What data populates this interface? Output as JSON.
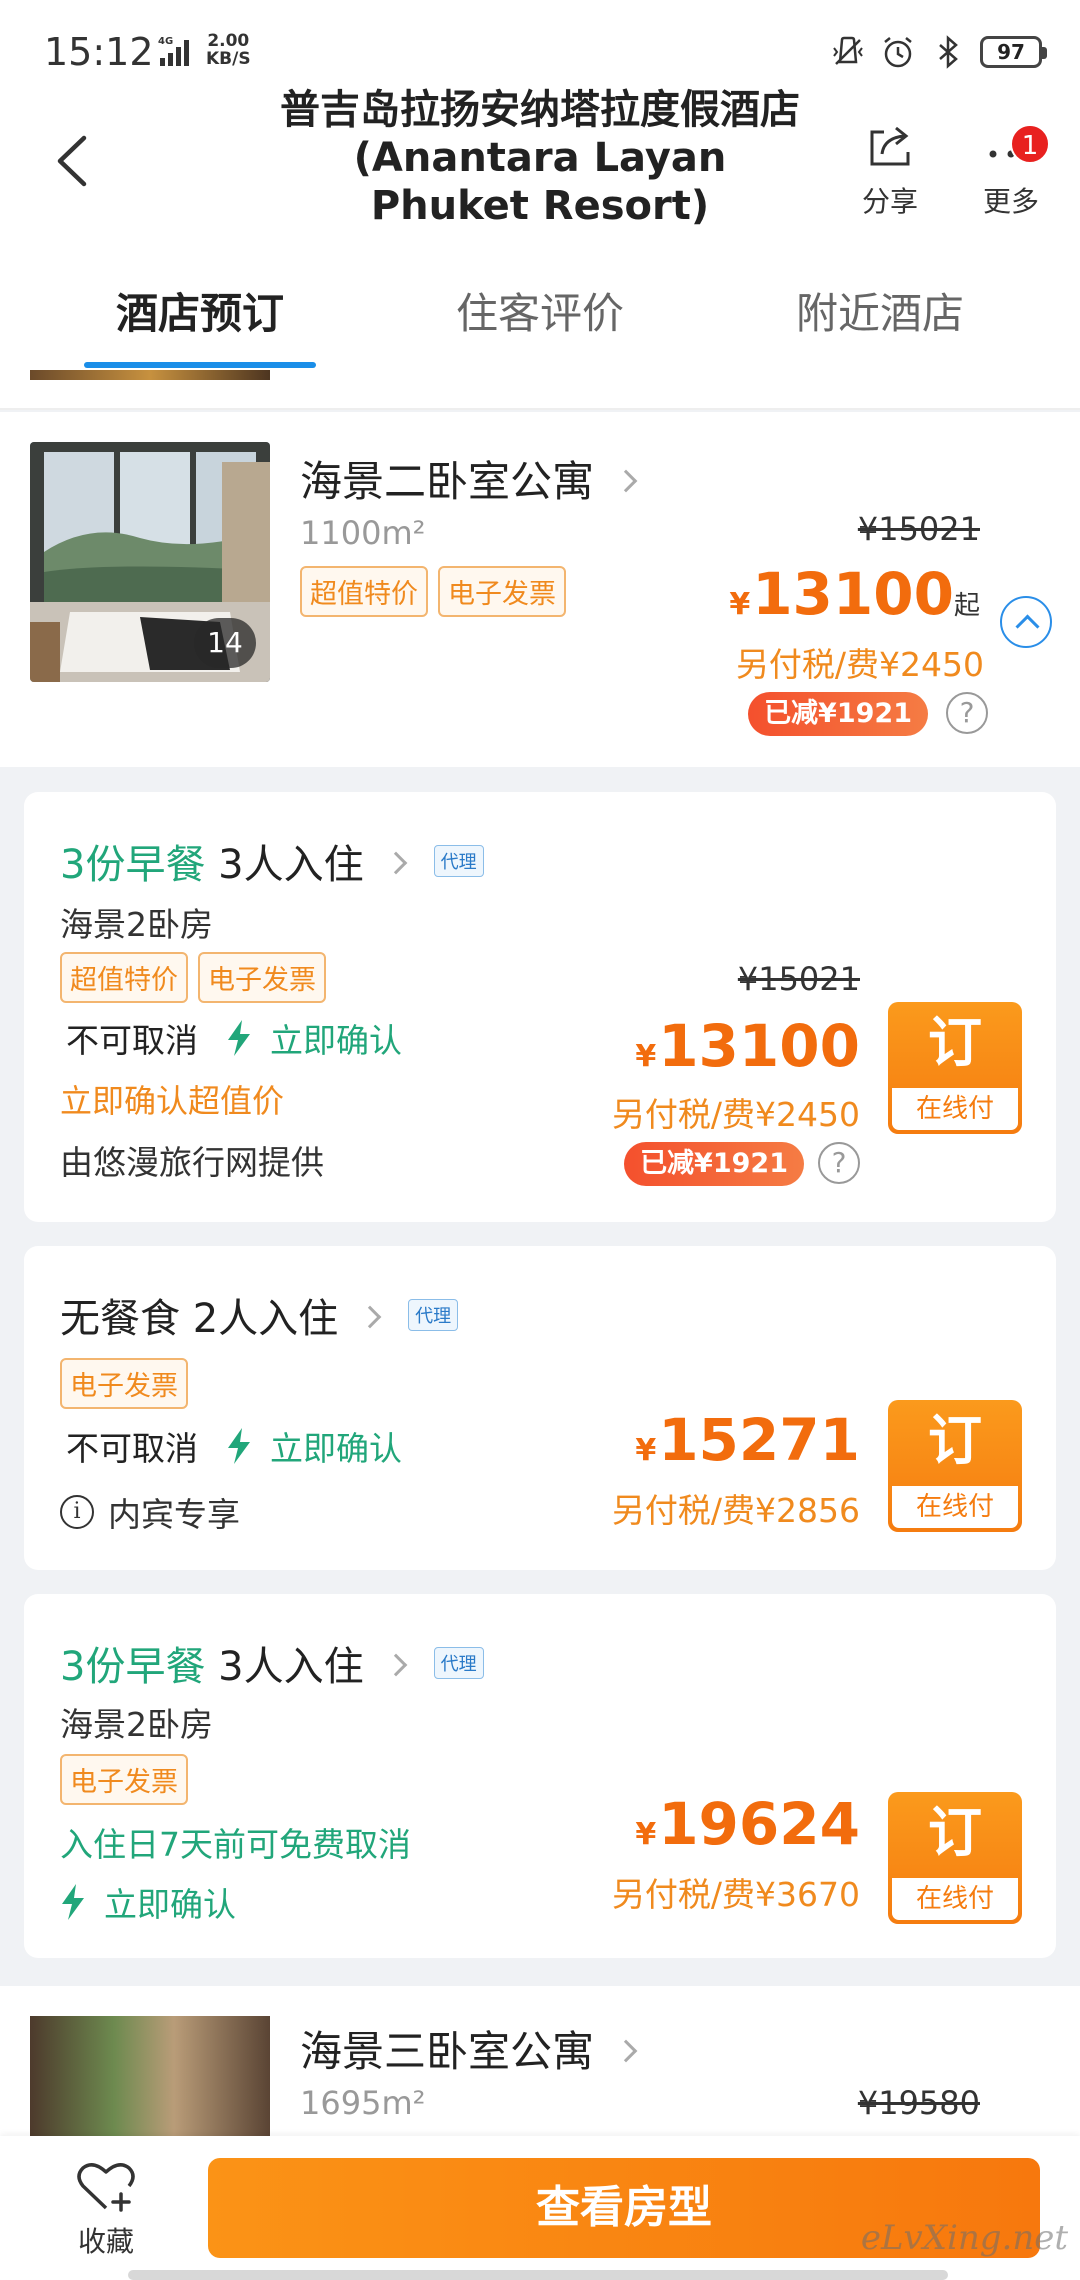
{
  "status_bar": {
    "time": "15:12",
    "network": "4G",
    "speed_value": "2.00",
    "speed_unit": "KB/S",
    "battery": "97"
  },
  "header": {
    "title": "普吉岛拉扬安纳塔拉度假酒店(Anantara Layan Phuket Resort)",
    "share_label": "分享",
    "more_label": "更多",
    "more_badge": "1"
  },
  "tabs": [
    {
      "label": "酒店预订",
      "active": true
    },
    {
      "label": "住客评价",
      "active": false
    },
    {
      "label": "附近酒店",
      "active": false
    }
  ],
  "room": {
    "name": "海景二卧室公寓",
    "area": "1100m²",
    "photo_count": "14",
    "tags": [
      "超值特价",
      "电子发票"
    ],
    "orig_price": "¥15021",
    "price_symbol": "¥",
    "price": "13100",
    "price_suffix": "起",
    "tax": "另付税/费¥2450",
    "discount": "已减¥1921"
  },
  "offers": [
    {
      "breakfast": "3份早餐",
      "guests": "3人入住",
      "agent_tag": "代理",
      "room_type": "海景2卧房",
      "tags": [
        "超值特价",
        "电子发票"
      ],
      "cancel_policy": "不可取消",
      "confirm": "立即确认",
      "note": "立即确认超值价",
      "provider": "由悠漫旅行网提供",
      "orig_price": "¥15021",
      "price_symbol": "¥",
      "price": "13100",
      "tax": "另付税/费¥2450",
      "discount": "已减¥1921",
      "book_label": "订",
      "book_sub": "在线付"
    },
    {
      "breakfast": "无餐食",
      "guests": "2人入住",
      "agent_tag": "代理",
      "tags": [
        "电子发票"
      ],
      "cancel_policy": "不可取消",
      "confirm": "立即确认",
      "info": "内宾专享",
      "price_symbol": "¥",
      "price": "15271",
      "tax": "另付税/费¥2856",
      "book_label": "订",
      "book_sub": "在线付"
    },
    {
      "breakfast": "3份早餐",
      "guests": "3人入住",
      "agent_tag": "代理",
      "room_type": "海景2卧房",
      "tags": [
        "电子发票"
      ],
      "cancel_policy": "入住日7天前可免费取消",
      "confirm": "立即确认",
      "price_symbol": "¥",
      "price": "19624",
      "tax": "另付税/费¥3670",
      "book_label": "订",
      "book_sub": "在线付"
    }
  ],
  "next_room": {
    "name": "海景三卧室公寓",
    "area": "1695m²",
    "orig_price": "¥19580"
  },
  "bottom_bar": {
    "favorite_label": "收藏",
    "view_rooms_label": "查看房型"
  },
  "watermark": "eLvXing.net",
  "colors": {
    "accent_orange": "#f26c0d",
    "accent_green": "#21a67a",
    "tab_indicator": "#1a8ee8"
  }
}
